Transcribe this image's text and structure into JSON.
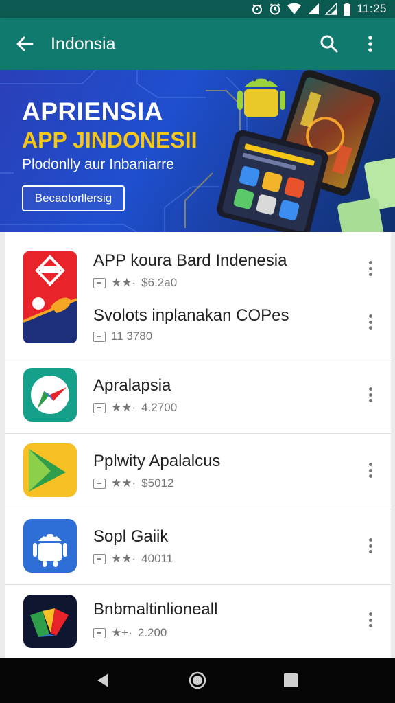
{
  "status_bar": {
    "time": "11:25",
    "icons": [
      "alarm-icon",
      "clock-icon",
      "wifi-icon",
      "cell-signal-icon",
      "cell-signal-icon",
      "battery-icon"
    ]
  },
  "app_bar": {
    "title": "Indonsia",
    "back_icon": "arrow-back-icon",
    "search_icon": "search-icon",
    "more_icon": "more-vert-icon",
    "color": "#0f7a6d"
  },
  "banner": {
    "title": "APRIENSIA",
    "subtitle": "APP JINDONESII",
    "tagline": "Plodonlly aur Inbaniarre",
    "button_label": "Becaotorllersig",
    "title_color": "#ffffff",
    "subtitle_color": "#f5c518",
    "background": "#1f4fcf"
  },
  "apps": [
    {
      "name": "APP koura Bard Indenesia",
      "meta": "$6.2a0",
      "rating": "★★·",
      "icon": "flag-red-app-icon"
    },
    {
      "name": "Svolots inplanakan COPes",
      "meta": "11 3780",
      "rating": "",
      "icon": ""
    },
    {
      "name": "Apralapsia",
      "meta": "4.2700",
      "rating": "★★·",
      "icon": "compass-app-icon"
    },
    {
      "name": "Pplwity Apalalcus",
      "meta": "$5012",
      "rating": "★★·",
      "icon": "play-triangle-app-icon"
    },
    {
      "name": "Sopl Gaiik",
      "meta": "40011",
      "rating": "★★·",
      "icon": "android-app-icon"
    },
    {
      "name": "Bnbmaltinlioneall",
      "meta": "2.200",
      "rating": "★+·",
      "icon": "colorful-shape-app-icon"
    }
  ],
  "nav_bar": {
    "back": "nav-back-icon",
    "home": "nav-home-icon",
    "recents": "nav-recents-icon"
  }
}
